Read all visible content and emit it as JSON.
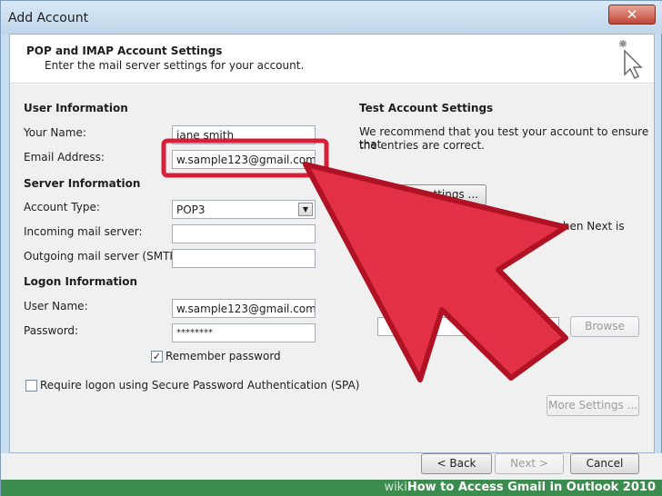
{
  "window": {
    "title": "Add Account",
    "close_glyph": "✕"
  },
  "header": {
    "title": "POP and IMAP Account Settings",
    "subtitle": "Enter the mail server settings for your account."
  },
  "user_info": {
    "heading": "User Information",
    "name_label": "Your Name:",
    "name_value": "jane smith",
    "email_label": "Email Address:",
    "email_value": "w.sample123@gmail.com"
  },
  "server_info": {
    "heading": "Server Information",
    "account_type_label": "Account Type:",
    "account_type_value": "POP3",
    "incoming_label": "Incoming mail server:",
    "incoming_value": "",
    "outgoing_label": "Outgoing mail server (SMTP):",
    "outgoing_value": ""
  },
  "logon_info": {
    "heading": "Logon Information",
    "username_label": "User Name:",
    "username_value": "w.sample123@gmail.com",
    "password_label": "Password:",
    "password_value": "********",
    "remember_label": "Remember password",
    "remember_checked": true,
    "spa_label": "Require logon using Secure Password Authentication (SPA)",
    "spa_checked": false
  },
  "test_settings": {
    "heading": "Test Account Settings",
    "description_line1": "We recommend that you test your account to ensure that",
    "description_line2": "the entries are correct.",
    "test_button_fragment": "ettings ...",
    "next_fragment": "s when Next is",
    "browse_label": "Browse",
    "more_settings_label": "More Settings ..."
  },
  "footer": {
    "back_label": "< Back",
    "next_label": "Next >",
    "cancel_label": "Cancel"
  },
  "watermark": {
    "prefix": "wiki",
    "text": "How to Access Gmail in Outlook 2010"
  },
  "colors": {
    "highlight_box": "#d6203a",
    "arrow_fill": "#e23045",
    "arrow_stroke": "#b01224"
  }
}
